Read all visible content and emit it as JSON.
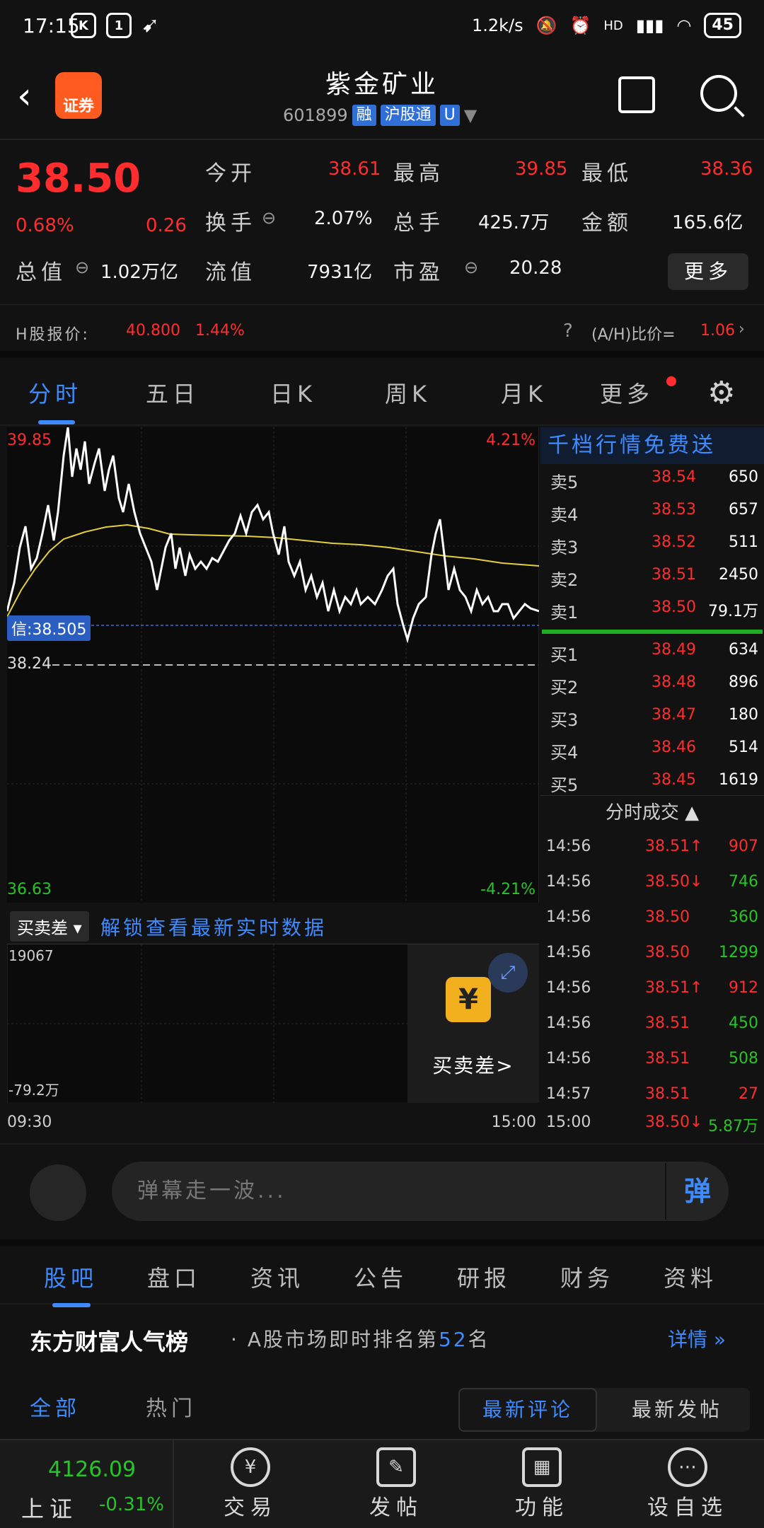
{
  "status": {
    "time": "17:15",
    "speed": "1.2k/s",
    "network": "HD",
    "battery": "45"
  },
  "header": {
    "title": "紫金矿业",
    "code": "601899",
    "tags": [
      "融",
      "沪股通",
      "U"
    ],
    "logo_text": "证券"
  },
  "quote": {
    "price": "38.50",
    "change_pct": "0.68%",
    "change": "0.26",
    "fields": [
      {
        "label": "今开",
        "value": "38.61",
        "color": "red"
      },
      {
        "label": "最高",
        "value": "39.85",
        "color": "red"
      },
      {
        "label": "最低",
        "value": "38.36",
        "color": "red"
      },
      {
        "label": "换手",
        "value": "2.07%",
        "color": "white"
      },
      {
        "label": "总手",
        "value": "425.7万",
        "color": "white"
      },
      {
        "label": "金额",
        "value": "165.6亿",
        "color": "white"
      },
      {
        "label": "总值",
        "value": "1.02万亿",
        "color": "white"
      },
      {
        "label": "流值",
        "value": "7931亿",
        "color": "white"
      },
      {
        "label": "市盈",
        "value": "20.28",
        "color": "white"
      }
    ],
    "more_label": "更多",
    "h_label": "H股报价:",
    "h_price": "40.800",
    "h_pct": "1.44%",
    "ah_label": "(A/H)比价=",
    "ah_value": "1.06"
  },
  "ktabs": [
    "分时",
    "五日",
    "日K",
    "周K",
    "月K",
    "更多"
  ],
  "chart": {
    "top_left": "39.85",
    "top_right": "4.21%",
    "avg_label": "信:38.505",
    "prev_close": "38.24",
    "bottom_left": "36.63",
    "bottom_right": "-4.21%",
    "vol_top": "19067",
    "vol_bottom": "-79.2万",
    "time_start": "09:30",
    "time_end": "15:00",
    "indicator": "买卖差",
    "unlock_text": "解锁查看最新实时数据",
    "lock_label": "买卖差>"
  },
  "book": {
    "header": "千档行情免费送",
    "asks": [
      {
        "label": "卖5",
        "price": "38.54",
        "vol": "650"
      },
      {
        "label": "卖4",
        "price": "38.53",
        "vol": "657"
      },
      {
        "label": "卖3",
        "price": "38.52",
        "vol": "511"
      },
      {
        "label": "卖2",
        "price": "38.51",
        "vol": "2450"
      },
      {
        "label": "卖1",
        "price": "38.50",
        "vol": "79.1万"
      }
    ],
    "bids": [
      {
        "label": "买1",
        "price": "38.49",
        "vol": "634"
      },
      {
        "label": "买2",
        "price": "38.48",
        "vol": "896"
      },
      {
        "label": "买3",
        "price": "38.47",
        "vol": "180"
      },
      {
        "label": "买4",
        "price": "38.46",
        "vol": "514"
      },
      {
        "label": "买5",
        "price": "38.45",
        "vol": "1619"
      }
    ],
    "trades_title": "分时成交",
    "trades": [
      {
        "time": "14:56",
        "price": "38.51↑",
        "vol": "907",
        "pc": "red",
        "vc": "red"
      },
      {
        "time": "14:56",
        "price": "38.50↓",
        "vol": "746",
        "pc": "red",
        "vc": "green"
      },
      {
        "time": "14:56",
        "price": "38.50",
        "vol": "360",
        "pc": "red",
        "vc": "green"
      },
      {
        "time": "14:56",
        "price": "38.50",
        "vol": "1299",
        "pc": "red",
        "vc": "green"
      },
      {
        "time": "14:56",
        "price": "38.51↑",
        "vol": "912",
        "pc": "red",
        "vc": "red"
      },
      {
        "time": "14:56",
        "price": "38.51",
        "vol": "450",
        "pc": "red",
        "vc": "green"
      },
      {
        "time": "14:56",
        "price": "38.51",
        "vol": "508",
        "pc": "red",
        "vc": "green"
      },
      {
        "time": "14:57",
        "price": "38.51",
        "vol": "27",
        "pc": "red",
        "vc": "red"
      },
      {
        "time": "15:00",
        "price": "38.50↓",
        "vol": "5.87万",
        "pc": "red",
        "vc": "green"
      }
    ]
  },
  "danmu": {
    "placeholder": "弹幕走一波...",
    "button": "弹"
  },
  "btabs": [
    "股吧",
    "盘口",
    "资讯",
    "公告",
    "研报",
    "财务",
    "资料"
  ],
  "popularity": {
    "brand": "东方财富人气榜",
    "text": "A股市场即时排名第",
    "rank": "52",
    "suffix": "名",
    "detail": "详情"
  },
  "filter": {
    "all": "全部",
    "hot": "热门",
    "latest_comment": "最新评论",
    "latest_post": "最新发帖"
  },
  "bottomnav": {
    "index_value": "4126.09",
    "index_name": "上证",
    "index_pct": "-0.31%",
    "items": [
      "交易",
      "发帖",
      "功能",
      "设自选"
    ]
  },
  "colors": {
    "red": "#ff2d2d",
    "green": "#27c427",
    "blue": "#3d8bff",
    "bg": "#121212"
  }
}
